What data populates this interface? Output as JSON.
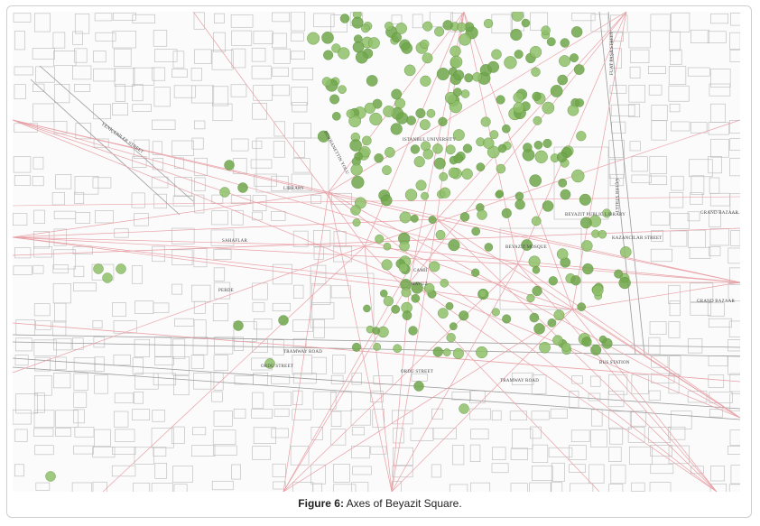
{
  "caption": {
    "prefix": "Figure 6:",
    "text": " Axes of Beyazit Square."
  },
  "labels": {
    "yeniceriler": "YENİÇERİLER STREET",
    "istanbul_university": "ISTANBUL UNIVERSITY",
    "fuat_pasa": "FUAT PAŞA STREET",
    "beyazit_public_library": "BEYAZIT PUBLIC LIBRARY",
    "ucler_street": "ÜÇLER STREET",
    "grand_bazaar_1": "GRAND BAZAAR",
    "grand_bazaar_2": "GRAND BAZAAR",
    "kazandasi": "KAZANCILAR STREET",
    "beyazit_mosque": "BEYAZIT MOSQUE",
    "camii": "CAMİİ",
    "havuz": "HAVUZ",
    "ordu_street_1": "ORDU STREET",
    "ordu_street_2": "ORDU STREET",
    "tramway_road_1": "TRAMWAY ROAD",
    "tramway_road_2": "TRAMWAY ROAD",
    "bus_station": "BUS STATION",
    "university_road": "BURHANETTİN YOLU",
    "library": "LIBRARY",
    "sahaflar": "SAHAFLAR",
    "perde": "PERDE"
  },
  "colors": {
    "axis": "#e8a0a6",
    "building": "#b9b9b9",
    "tree": "#8fbf6a",
    "tree_dark": "#6fa64a"
  }
}
